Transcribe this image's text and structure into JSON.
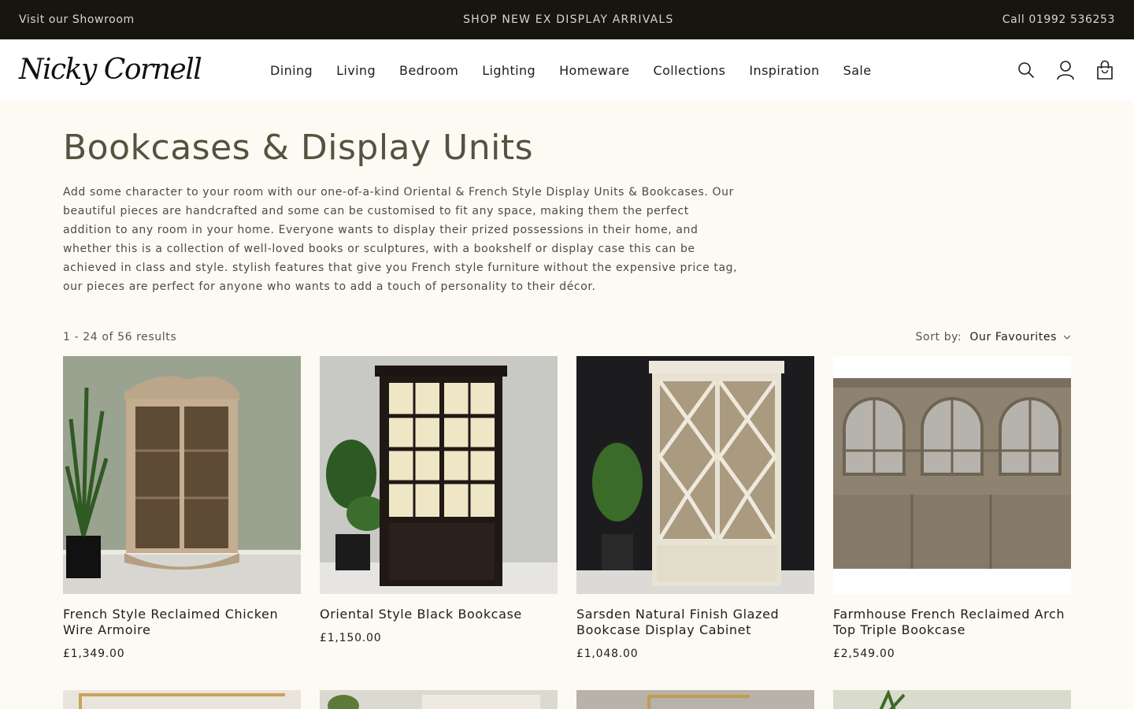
{
  "announcement": {
    "left": "Visit our Showroom",
    "center": "SHOP NEW EX DISPLAY ARRIVALS",
    "right": "Call 01992 536253"
  },
  "header": {
    "logo": "Nicky Cornell",
    "nav": [
      {
        "label": "Dining"
      },
      {
        "label": "Living"
      },
      {
        "label": "Bedroom"
      },
      {
        "label": "Lighting"
      },
      {
        "label": "Homeware"
      },
      {
        "label": "Collections"
      },
      {
        "label": "Inspiration"
      },
      {
        "label": "Sale"
      }
    ],
    "icons": [
      "search-icon",
      "account-icon",
      "cart-icon"
    ]
  },
  "collection": {
    "title": "Bookcases & Display Units",
    "description": "Add some character to your room with our one-of-a-kind Oriental & French Style Display Units & Bookcases. Our beautiful pieces are handcrafted and some can be customised to fit any space, making them the perfect addition to any room in your home. Everyone wants to display their prized possessions in their home, and whether this is a collection of well-loved books or sculptures, with a bookshelf or display case this can be achieved in class and style. stylish features that give you French style furniture without the expensive price tag, our pieces are perfect for anyone who wants to add a touch of personality to their décor.",
    "results": "1 - 24 of 56 results",
    "sort_label": "Sort by:",
    "sort_value": "Our Favourites"
  },
  "products": [
    {
      "title": "French Style Reclaimed Chicken Wire Armoire",
      "price": "£1,349.00"
    },
    {
      "title": "Oriental Style Black Bookcase",
      "price": "£1,150.00"
    },
    {
      "title": "Sarsden Natural Finish Glazed Bookcase Display Cabinet",
      "price": "£1,048.00"
    },
    {
      "title": "Farmhouse French Reclaimed Arch Top Triple Bookcase",
      "price": "£2,549.00"
    }
  ],
  "colors": {
    "announcement_bg": "#16150f",
    "page_bg": "#fdfaf4",
    "title": "#56523f"
  }
}
